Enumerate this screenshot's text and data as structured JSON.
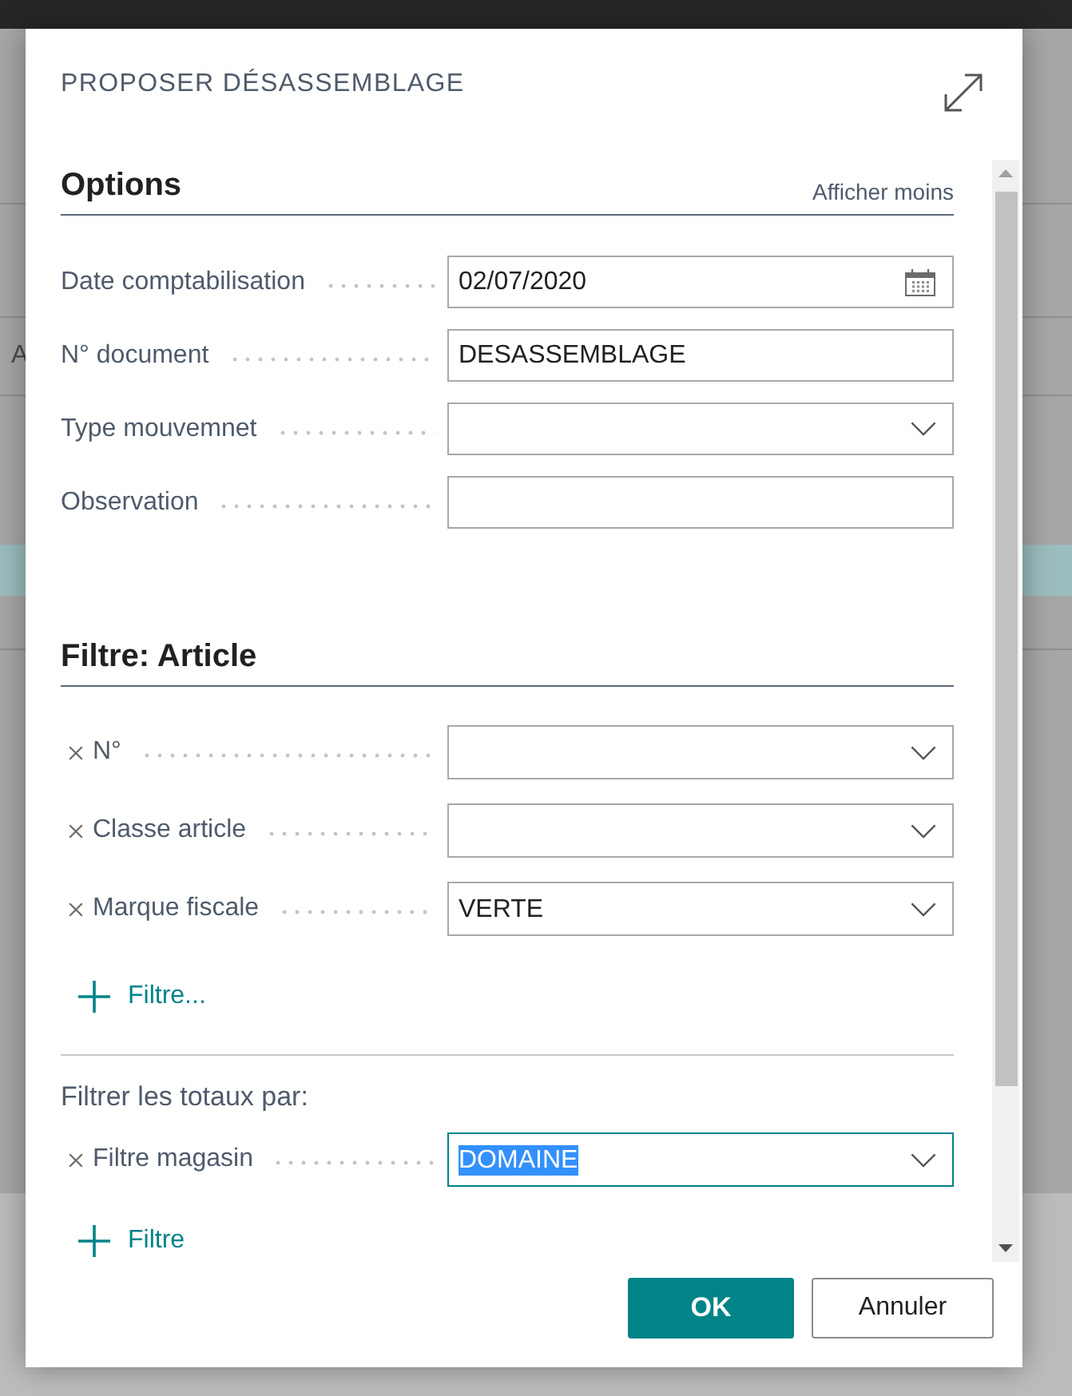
{
  "background_page": {
    "text": "A"
  },
  "dialog": {
    "title": "PROPOSER DÉSASSEMBLAGE"
  },
  "options": {
    "heading": "Options",
    "toggle_link": "Afficher moins",
    "fields": [
      {
        "label": "Date comptabilisation",
        "kind": "date",
        "value": "02/07/2020"
      },
      {
        "label": "N° document",
        "kind": "text",
        "value": "DESASSEMBLAGE"
      },
      {
        "label": "Type mouvemnet",
        "kind": "select"
      },
      {
        "label": "Observation",
        "kind": "text"
      }
    ]
  },
  "article_filter": {
    "heading": "Filtre: Article",
    "filters": [
      {
        "label": "N°",
        "kind": "select",
        "focused": false
      },
      {
        "label": "Classe article",
        "kind": "select",
        "focused": false
      },
      {
        "label": "Marque fiscale",
        "kind": "select",
        "value": "VERTE",
        "focused": false
      }
    ],
    "add_filter": "Filtre..."
  },
  "totals_filter": {
    "heading": "Filtrer les totaux par:",
    "filters": [
      {
        "label": "Filtre magasin",
        "kind": "select",
        "value": "DOMAINE",
        "focused": true
      }
    ],
    "add_filter": "Filtre"
  },
  "buttons": [
    {
      "label": "OK",
      "kind": "primary"
    },
    {
      "label": "Annuler",
      "kind": "secondary"
    }
  ]
}
